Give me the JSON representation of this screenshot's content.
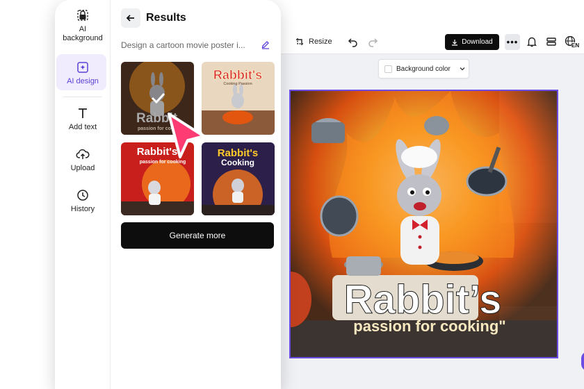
{
  "toolbar": {
    "resize_label": "Resize",
    "download_label": "Download",
    "more_label": "•••",
    "language_label": "EN"
  },
  "canvas": {
    "background_color_label": "Background color",
    "poster_title": "Rabbit’s",
    "poster_subtitle": "passion for cooking\""
  },
  "rail": {
    "items": [
      {
        "label": "AI background",
        "icon": "ai-background-icon"
      },
      {
        "label": "AI design",
        "icon": "ai-design-icon",
        "active": true
      },
      {
        "label": "Add text",
        "icon": "text-icon"
      },
      {
        "label": "Upload",
        "icon": "upload-icon"
      },
      {
        "label": "History",
        "icon": "history-icon"
      }
    ]
  },
  "results": {
    "title": "Results",
    "prompt": "Design a cartoon movie poster i...",
    "generate_label": "Generate more",
    "thumbnails": [
      {
        "title": "Rabbit",
        "subtitle": "passion for coo",
        "selected": true
      },
      {
        "title": "Rabbit's",
        "subtitle": "Cooking Passion"
      },
      {
        "title": "Rabbit's",
        "subtitle": "passion for cooking"
      },
      {
        "title": "Rabbit's",
        "subtitle": "Cooking"
      }
    ]
  },
  "colors": {
    "accent": "#6b4de6",
    "active_bg": "#f0ecfd",
    "dark_button": "#0d0d0d",
    "cursor": "#ff3b73"
  }
}
